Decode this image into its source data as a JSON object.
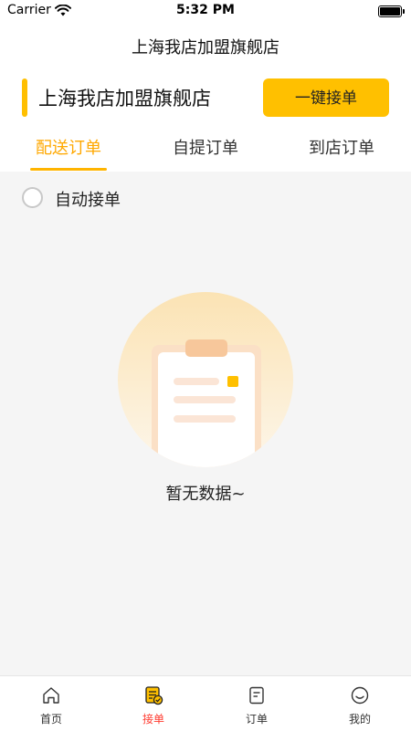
{
  "status_bar": {
    "carrier": "Carrier",
    "time": "5:32 PM"
  },
  "header": {
    "title": "上海我店加盟旗舰店"
  },
  "store": {
    "name": "上海我店加盟旗舰店",
    "accept_button": "一键接单"
  },
  "tabs": [
    {
      "label": "配送订单",
      "active": true
    },
    {
      "label": "自提订单",
      "active": false
    },
    {
      "label": "到店订单",
      "active": false
    }
  ],
  "auto_accept": {
    "label": "自动接单",
    "checked": false
  },
  "empty_state": {
    "text": "暂无数据~"
  },
  "bottom_nav": [
    {
      "label": "首页",
      "icon": "home-icon",
      "active": false
    },
    {
      "label": "接单",
      "icon": "accept-orders-icon",
      "active": true
    },
    {
      "label": "订单",
      "icon": "orders-icon",
      "active": false
    },
    {
      "label": "我的",
      "icon": "profile-icon",
      "active": false
    }
  ],
  "colors": {
    "accent": "#ffc000",
    "tab_active": "#ffa800",
    "nav_active": "#ff3b30"
  }
}
